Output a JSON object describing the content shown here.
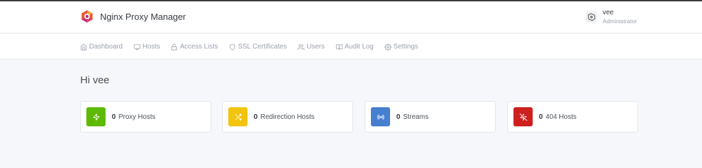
{
  "app": {
    "title": "Nginx Proxy Manager"
  },
  "user": {
    "name": "vee",
    "role": "Administrator"
  },
  "nav": {
    "items": [
      {
        "label": "Dashboard",
        "icon": "home-icon"
      },
      {
        "label": "Hosts",
        "icon": "monitor-icon"
      },
      {
        "label": "Access Lists",
        "icon": "lock-icon"
      },
      {
        "label": "SSL Certificates",
        "icon": "shield-icon"
      },
      {
        "label": "Users",
        "icon": "users-icon"
      },
      {
        "label": "Audit Log",
        "icon": "book-open-icon"
      },
      {
        "label": "Settings",
        "icon": "gear-icon"
      }
    ]
  },
  "greeting": "Hi vee",
  "stats": [
    {
      "count": "0",
      "label": "Proxy Hosts",
      "icon": "zap-icon",
      "color": "#5eba00"
    },
    {
      "count": "0",
      "label": "Redirection Hosts",
      "icon": "shuffle-icon",
      "color": "#f1c40f"
    },
    {
      "count": "0",
      "label": "Streams",
      "icon": "radio-icon",
      "color": "#467fcf"
    },
    {
      "count": "0",
      "label": "404 Hosts",
      "icon": "zap-off-icon",
      "color": "#cd201f"
    }
  ]
}
